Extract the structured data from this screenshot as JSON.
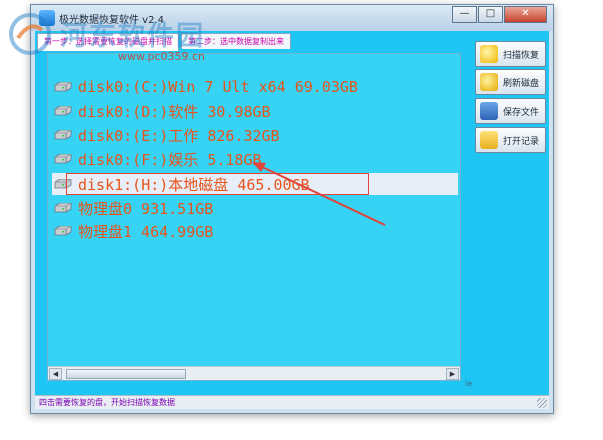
{
  "window": {
    "title": "极光数据恢复软件 v2.4",
    "buttons": {
      "minimize": "—",
      "maximize": "□",
      "close": "✕"
    }
  },
  "tabs": [
    {
      "label": "第一步：选择需要恢复的磁盘并扫描"
    },
    {
      "label": "第二步：选中数据复制出来"
    }
  ],
  "disk_list": {
    "items": [
      {
        "label": "disk0:(C:)Win 7 Ult x64 69.03GB"
      },
      {
        "label": "disk0:(D:)软件 30.98GB"
      },
      {
        "label": "disk0:(E:)工作 826.32GB"
      },
      {
        "label": "disk0:(F:)娱乐 5.18GB"
      },
      {
        "label": "disk1:(H:)本地磁盘 465.00GB"
      },
      {
        "label": "物理盘0 931.51GB"
      },
      {
        "label": "物理盘1 464.99GB"
      }
    ],
    "selected_index": 4
  },
  "side_buttons": [
    {
      "label": "扫描恢复",
      "icon": "scan-icon"
    },
    {
      "label": "刷新磁盘",
      "icon": "refresh-icon"
    },
    {
      "label": "保存文件",
      "icon": "save-icon"
    },
    {
      "label": "打开记录",
      "icon": "folder-icon"
    }
  ],
  "status_bar": {
    "text": "四击需要恢复的盘，开始扫描恢复数据"
  },
  "side_mark": "ie",
  "watermark": {
    "text": "河东软件园",
    "url": "www.pc0359.cn"
  },
  "colors": {
    "client_bg": "#1fc5f3",
    "list_text": "#e8541a",
    "annotation_red": "#e0443a",
    "tab_text": "#cc00aa"
  }
}
